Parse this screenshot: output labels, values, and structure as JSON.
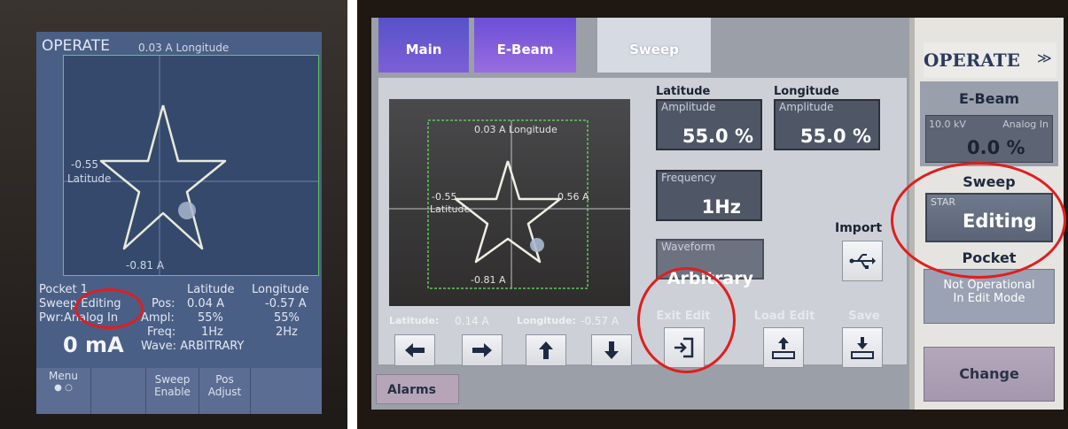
{
  "left_device": {
    "title": "OPERATE",
    "plot": {
      "top_label": "0.03 A Longitude",
      "left_value": "-0.55",
      "left_axis": "Latitude",
      "bottom_label": "-0.81 A"
    },
    "info": {
      "pocket_label": "Pocket",
      "pocket_value": "1",
      "sweep_label": "Sweep",
      "sweep_value": "Editing",
      "pwr_label": "Pwr",
      "pwr_value": "Analog In",
      "current": "0 mA",
      "col_latitude": "Latitude",
      "col_longitude": "Longitude",
      "pos_label": "Pos:",
      "pos_lat": "0.04 A",
      "pos_lon": "-0.57 A",
      "ampl_label": "Ampl:",
      "ampl_lat": "55%",
      "ampl_lon": "55%",
      "freq_label": "Freq:",
      "freq_lat": "1Hz",
      "freq_lon": "2Hz",
      "wave_label": "Wave:",
      "wave_value": "ARBITRARY"
    },
    "softkeys": {
      "menu": "Menu",
      "menu_dots": "● ○",
      "sweep_enable": "Sweep Enable",
      "pos_adjust": "Pos Adjust"
    }
  },
  "right_device": {
    "tabs": [
      "Main",
      "E-Beam",
      "Sweep"
    ],
    "plot": {
      "top_label": "0.03 A  Longitude",
      "left_value": "-0.55",
      "left_axis": "Latitude",
      "right_value": "0.56 A",
      "bottom_label": "-0.81 A"
    },
    "latitude_header": "Latitude",
    "longitude_header": "Longitude",
    "amplitude_label": "Amplitude",
    "lat_amplitude": "55.0 %",
    "lon_amplitude": "55.0 %",
    "frequency_label": "Frequency",
    "frequency_value": "1Hz",
    "waveform_label": "Waveform",
    "waveform_value": "Arbitrary",
    "pos_row": {
      "lat_label": "Latitude:",
      "lat_value": "0.14 A",
      "lon_label": "Longitude:",
      "lon_value": "-0.57 A"
    },
    "import_label": "Import",
    "exit_edit_label": "Exit Edit",
    "load_edit_label": "Load Edit",
    "save_label": "Save",
    "alarms_label": "Alarms",
    "side": {
      "operate": "OPERATE",
      "ebeam_head": "E-Beam",
      "ebeam_kv": "10.0 kV",
      "ebeam_mode": "Analog In",
      "ebeam_value": "0.0 %",
      "sweep_head": "Sweep",
      "sweep_pattern": "STAR",
      "sweep_state": "Editing",
      "pocket_head": "Pocket",
      "pocket_line1": "Not Operational",
      "pocket_line2": "In Edit Mode",
      "change_label": "Change"
    }
  },
  "colors": {
    "annotation_red": "#e01e1e",
    "plot_green_border": "#5ec85a",
    "left_screen_bg": "#4a5f86"
  }
}
